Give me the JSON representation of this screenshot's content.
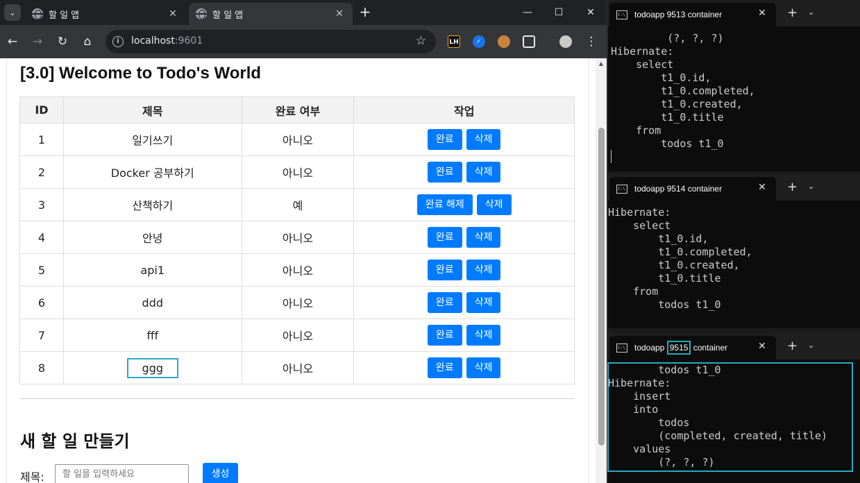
{
  "browser": {
    "tabs": [
      {
        "title": "할 일 앱",
        "active": false
      },
      {
        "title": "할 일 앱",
        "active": true
      }
    ],
    "url_host": "localhost",
    "url_port": ":9601",
    "extensions": [
      "LH",
      "✓"
    ]
  },
  "page": {
    "heading": "[3.0] Welcome to Todo's World",
    "table": {
      "headers": [
        "ID",
        "제목",
        "완료 여부",
        "작업"
      ],
      "rows": [
        {
          "id": "1",
          "title": "일기쓰기",
          "done": "아니오",
          "actions": [
            "완료",
            "삭제"
          ]
        },
        {
          "id": "2",
          "title": "Docker 공부하기",
          "done": "아니오",
          "actions": [
            "완료",
            "삭제"
          ]
        },
        {
          "id": "3",
          "title": "산책하기",
          "done": "예",
          "actions": [
            "완료 해제",
            "삭제"
          ]
        },
        {
          "id": "4",
          "title": "안녕",
          "done": "아니오",
          "actions": [
            "완료",
            "삭제"
          ]
        },
        {
          "id": "5",
          "title": "api1",
          "done": "아니오",
          "actions": [
            "완료",
            "삭제"
          ]
        },
        {
          "id": "6",
          "title": "ddd",
          "done": "아니오",
          "actions": [
            "완료",
            "삭제"
          ]
        },
        {
          "id": "7",
          "title": "fff",
          "done": "아니오",
          "actions": [
            "완료",
            "삭제"
          ]
        },
        {
          "id": "8",
          "title": "ggg",
          "done": "아니오",
          "actions": [
            "완료",
            "삭제"
          ]
        }
      ]
    },
    "create": {
      "heading": "새 할 일 만들기",
      "label": "제목:",
      "placeholder": "할 일을 입력하세요",
      "button": "생성"
    }
  },
  "terminals": [
    {
      "title": "todoapp 9513 container",
      "output": "         (?, ?, ?)\nHibernate:\n    select\n        t1_0.id,\n        t1_0.completed,\n        t1_0.created,\n        t1_0.title\n    from\n        todos t1_0"
    },
    {
      "title": "todoapp 9514 container",
      "output": "Hibernate:\n    select\n        t1_0.id,\n        t1_0.completed,\n        t1_0.created,\n        t1_0.title\n    from\n        todos t1_0"
    },
    {
      "title_prefix": "todoapp ",
      "title_port": "9515",
      "title_suffix": " container",
      "output": "        todos t1_0\nHibernate:\n    insert\n    into\n        todos\n        (completed, created, title)\n    values\n        (?, ?, ?)"
    }
  ],
  "colors": {
    "accent": "#007bff",
    "highlight": "#26a9c7",
    "terminal_bg": "#0c0c0c"
  }
}
